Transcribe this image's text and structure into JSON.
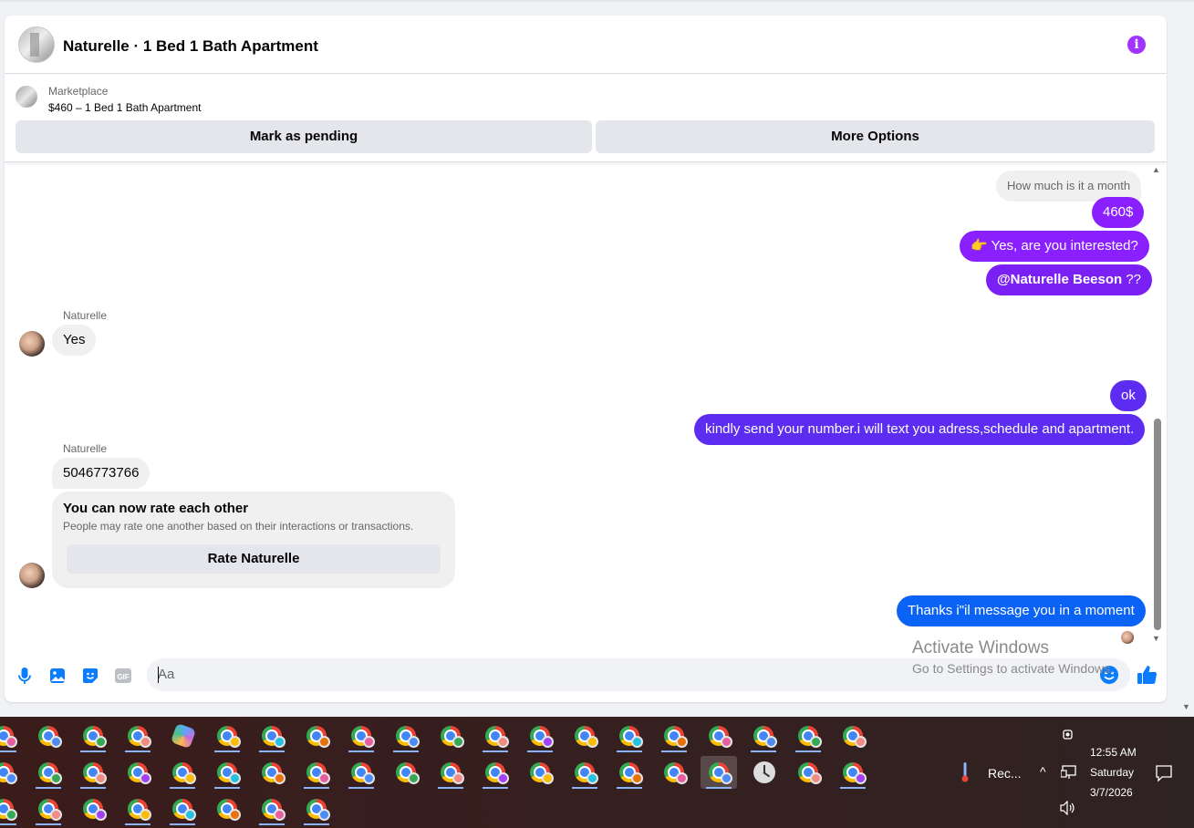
{
  "header": {
    "title": "Naturelle · 1 Bed 1 Bath Apartment"
  },
  "marketplace": {
    "label": "Marketplace",
    "listing": "$460 – 1 Bed 1 Bath Apartment",
    "mark_pending_label": "Mark as pending",
    "more_options_label": "More Options"
  },
  "messages": {
    "quoted_text": "How much is it a month",
    "m1": "460$",
    "m2_emoji": "👉",
    "m2_text": " Yes, are you interested?",
    "m3_mention": "@Naturelle Beeson",
    "m3_rest": " ??",
    "sender1": "Naturelle",
    "reply1": "Yes",
    "m4": "ok",
    "m5": "kindly send your number.i will text you adress,schedule and apartment.",
    "sender2": "Naturelle",
    "reply2": "5046773766",
    "rate_title": "You can now rate each other",
    "rate_sub": "People may rate one another based on their interactions or transactions.",
    "rate_button": "Rate Naturelle",
    "m6": "Thanks i\"il message you in a moment"
  },
  "composer": {
    "placeholder": "Aa",
    "gif_label": "GIF"
  },
  "watermark": {
    "title": "Activate Windows",
    "subtitle": "Go to Settings to activate Windows."
  },
  "tray": {
    "recorder_label": "Rec...",
    "time": "12:55 AM",
    "day": "Saturday",
    "date": "3/7/2026"
  },
  "colors": {
    "accent_purple": "#8a1fff",
    "accent_violet": "#5c2cf0",
    "accent_blue": "#0b63f6",
    "info_icon": "#a033ff",
    "composer_icons": "#0a7cff"
  }
}
